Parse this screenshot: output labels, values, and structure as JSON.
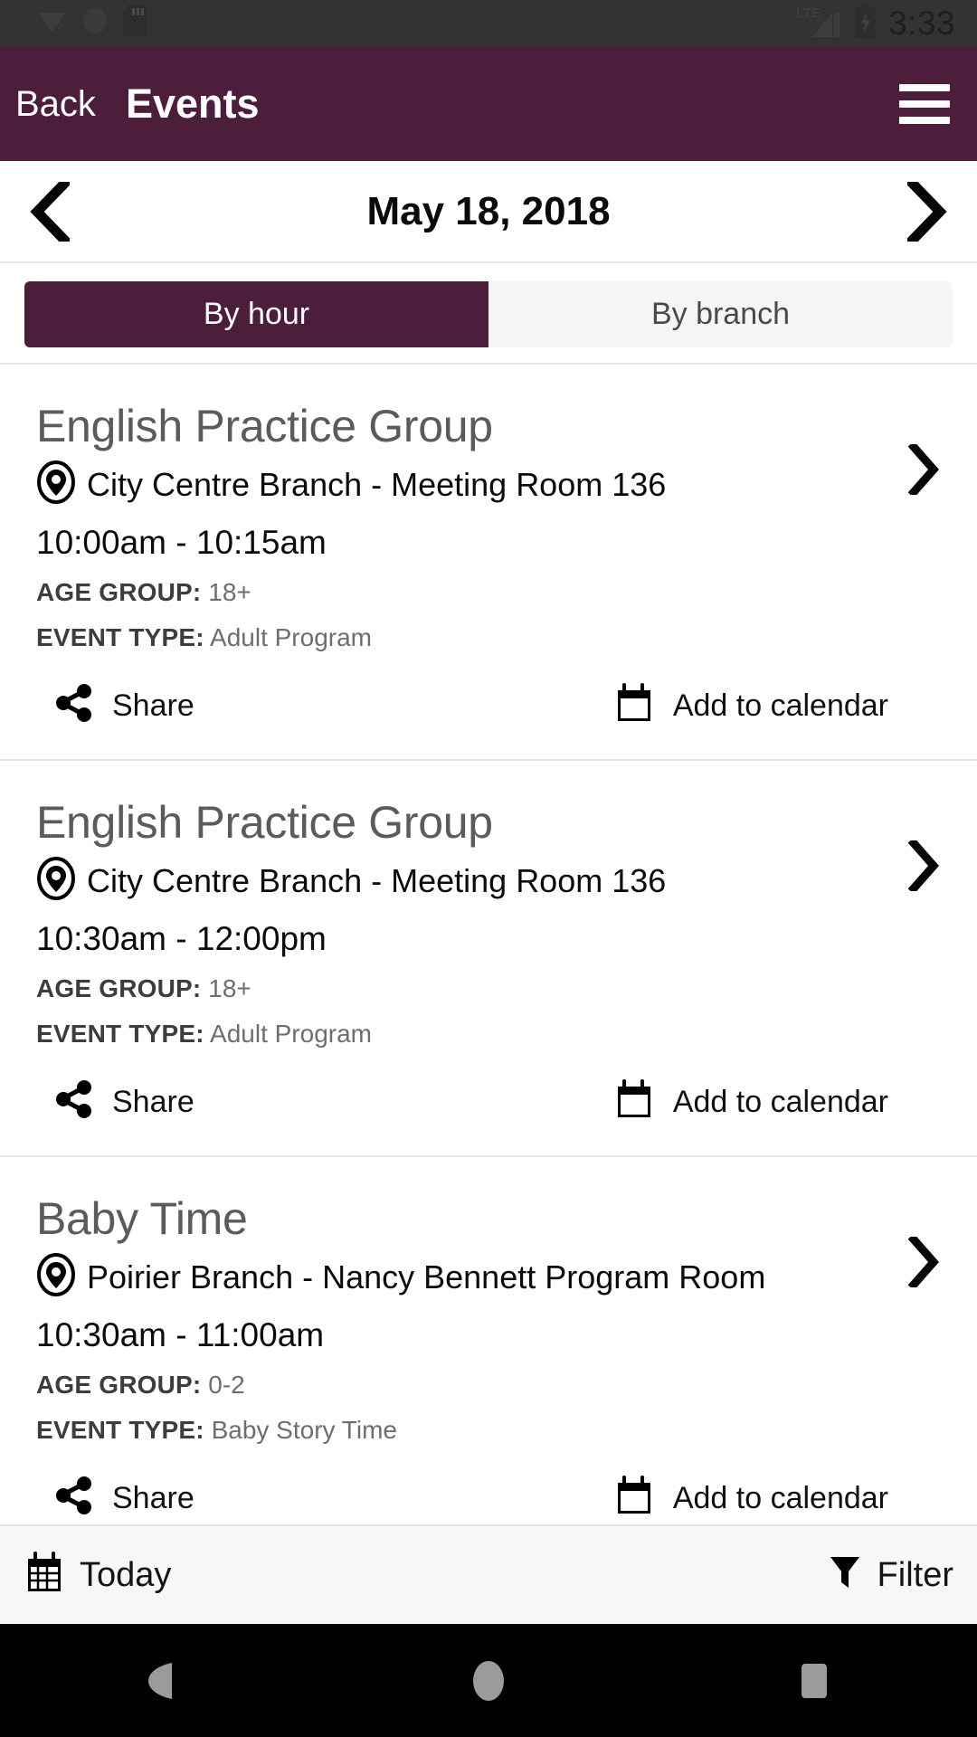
{
  "status_bar": {
    "time": "3:33",
    "network_label": "LTE",
    "icons": [
      "wifi-unknown-icon",
      "circle-icon",
      "sd-card-icon",
      "signal-icon",
      "battery-charging-icon"
    ]
  },
  "app_bar": {
    "back_label": "Back",
    "title": "Events",
    "menu_icon": "hamburger-menu-icon"
  },
  "date_nav": {
    "prev_icon": "chevron-left-icon",
    "date": "May 18, 2018",
    "next_icon": "chevron-right-icon"
  },
  "tabs": [
    {
      "label": "By hour",
      "selected": true
    },
    {
      "label": "By branch",
      "selected": false
    }
  ],
  "events": [
    {
      "title": "English Practice Group",
      "location": "City Centre Branch - Meeting Room 136",
      "time": "10:00am - 10:15am",
      "age_group_key": "AGE GROUP:",
      "age_group_value": "18+",
      "event_type_key": "EVENT TYPE:",
      "event_type_value": "Adult Program",
      "share_label": "Share",
      "calendar_label": "Add to calendar"
    },
    {
      "title": "English Practice Group",
      "location": "City Centre Branch - Meeting Room 136",
      "time": "10:30am - 12:00pm",
      "age_group_key": "AGE GROUP:",
      "age_group_value": "18+",
      "event_type_key": "EVENT TYPE:",
      "event_type_value": "Adult Program",
      "share_label": "Share",
      "calendar_label": "Add to calendar"
    },
    {
      "title": "Baby Time",
      "location": "Poirier Branch - Nancy Bennett Program Room",
      "time": "10:30am - 11:00am",
      "age_group_key": "AGE GROUP:",
      "age_group_value": "0-2",
      "event_type_key": "EVENT TYPE:",
      "event_type_value": "Baby Story Time",
      "share_label": "Share",
      "calendar_label": "Add to calendar"
    }
  ],
  "bottom_bar": {
    "today_label": "Today",
    "today_icon": "calendar-icon",
    "filter_label": "Filter",
    "filter_icon": "funnel-icon"
  },
  "nav_bar": {
    "back_icon": "triangle-back-icon",
    "home_icon": "circle-home-icon",
    "recents_icon": "square-recents-icon"
  },
  "colors": {
    "brand_purple": "#4d1e3c",
    "status_bar": "#333333",
    "tab_inactive": "#f5f5f5",
    "bottom_bar": "#f7f7f7",
    "title_gray": "#5b5b5b"
  }
}
